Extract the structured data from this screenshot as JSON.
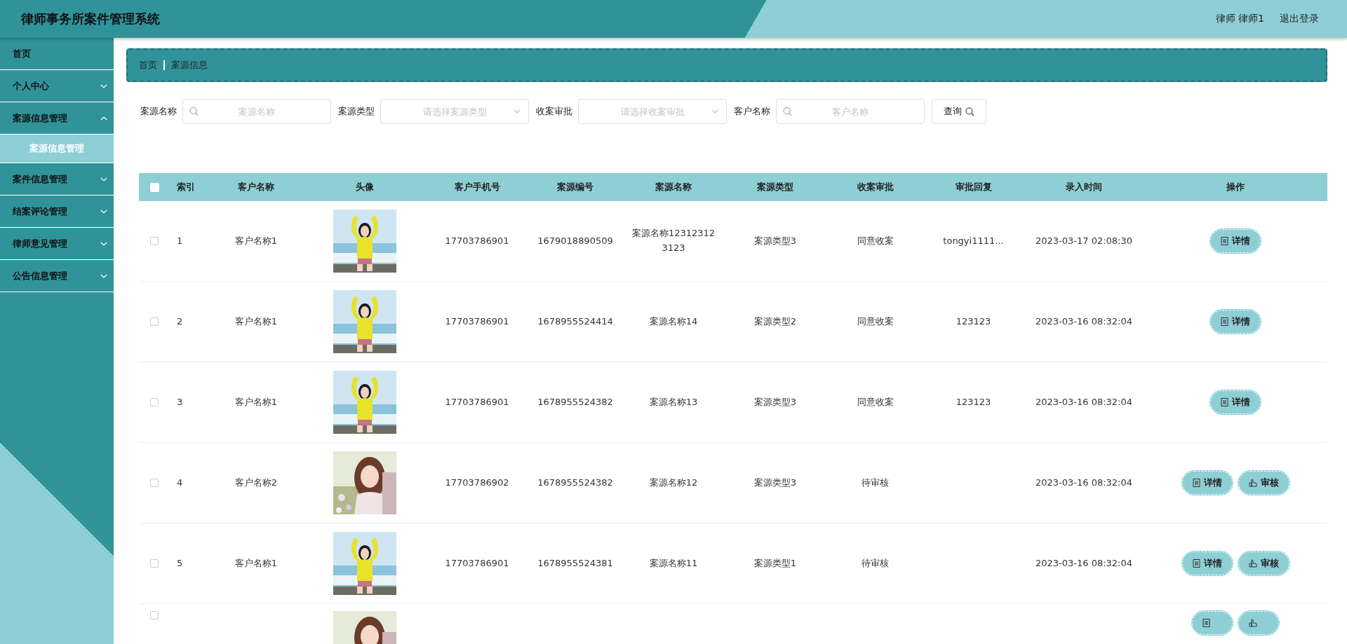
{
  "header": {
    "title": "律师事务所案件管理系统",
    "user": "律师 律师1",
    "logout": "退出登录"
  },
  "sidebar": {
    "items": [
      {
        "label": "首页",
        "expandable": false
      },
      {
        "label": "个人中心",
        "expandable": true,
        "expanded": false
      },
      {
        "label": "案源信息管理",
        "expandable": true,
        "expanded": true,
        "children": [
          {
            "label": "案源信息管理",
            "selected": true
          }
        ]
      },
      {
        "label": "案件信息管理",
        "expandable": true,
        "expanded": false
      },
      {
        "label": "结案评论管理",
        "expandable": true,
        "expanded": false
      },
      {
        "label": "律师意见管理",
        "expandable": true,
        "expanded": false
      },
      {
        "label": "公告信息管理",
        "expandable": true,
        "expanded": false
      }
    ]
  },
  "breadcrumb": [
    "首页",
    "案源信息"
  ],
  "search": {
    "fields": [
      {
        "kind": "text",
        "label": "案源名称",
        "placeholder": "案源名称"
      },
      {
        "kind": "select",
        "label": "案源类型",
        "placeholder": "请选择案源类型"
      },
      {
        "kind": "select",
        "label": "收案审批",
        "placeholder": "请选择收案审批"
      },
      {
        "kind": "text",
        "label": "客户名称",
        "placeholder": "客户名称"
      }
    ],
    "button": "查询"
  },
  "table": {
    "all_checked": false,
    "columns": [
      "索引",
      "客户名称",
      "头像",
      "客户手机号",
      "案源编号",
      "案源名称",
      "案源类型",
      "收案审批",
      "审批回复",
      "录入时间",
      "操作"
    ],
    "rows": [
      {
        "checked": false,
        "cells": [
          "1",
          "客户名称1",
          "",
          "17703786901",
          "1679018890509",
          "案源名称123123123123",
          "案源类型3",
          "同意收案",
          "tongyi1111...",
          "2023-03-17 02:08:30"
        ],
        "actions": [
          {
            "kind": "detail",
            "label": "详情"
          }
        ]
      },
      {
        "checked": false,
        "cells": [
          "2",
          "客户名称1",
          "",
          "17703786901",
          "1678955524414",
          "案源名称14",
          "案源类型2",
          "同意收案",
          "123123",
          "2023-03-16 08:32:04"
        ],
        "actions": [
          {
            "kind": "detail",
            "label": "详情"
          }
        ]
      },
      {
        "checked": false,
        "cells": [
          "3",
          "客户名称1",
          "",
          "17703786901",
          "1678955524382",
          "案源名称13",
          "案源类型3",
          "同意收案",
          "123123",
          "2023-03-16 08:32:04"
        ],
        "actions": [
          {
            "kind": "detail",
            "label": "详情"
          }
        ]
      },
      {
        "checked": false,
        "cells": [
          "4",
          "客户名称2",
          "",
          "17703786902",
          "1678955524382",
          "案源名称12",
          "案源类型3",
          "待审核",
          "",
          "2023-03-16 08:32:04"
        ],
        "actions": [
          {
            "kind": "detail",
            "label": "详情"
          },
          {
            "kind": "review",
            "label": "审核"
          }
        ]
      },
      {
        "checked": false,
        "cells": [
          "5",
          "客户名称1",
          "",
          "17703786901",
          "1678955524381",
          "案源名称11",
          "案源类型1",
          "待审核",
          "",
          "2023-03-16 08:32:04"
        ],
        "actions": [
          {
            "kind": "detail",
            "label": "详情"
          },
          {
            "kind": "review",
            "label": "审核"
          }
        ]
      },
      {
        "checked": false,
        "actions": [
          {
            "kind": "detail"
          },
          {
            "kind": "review"
          }
        ]
      }
    ]
  }
}
